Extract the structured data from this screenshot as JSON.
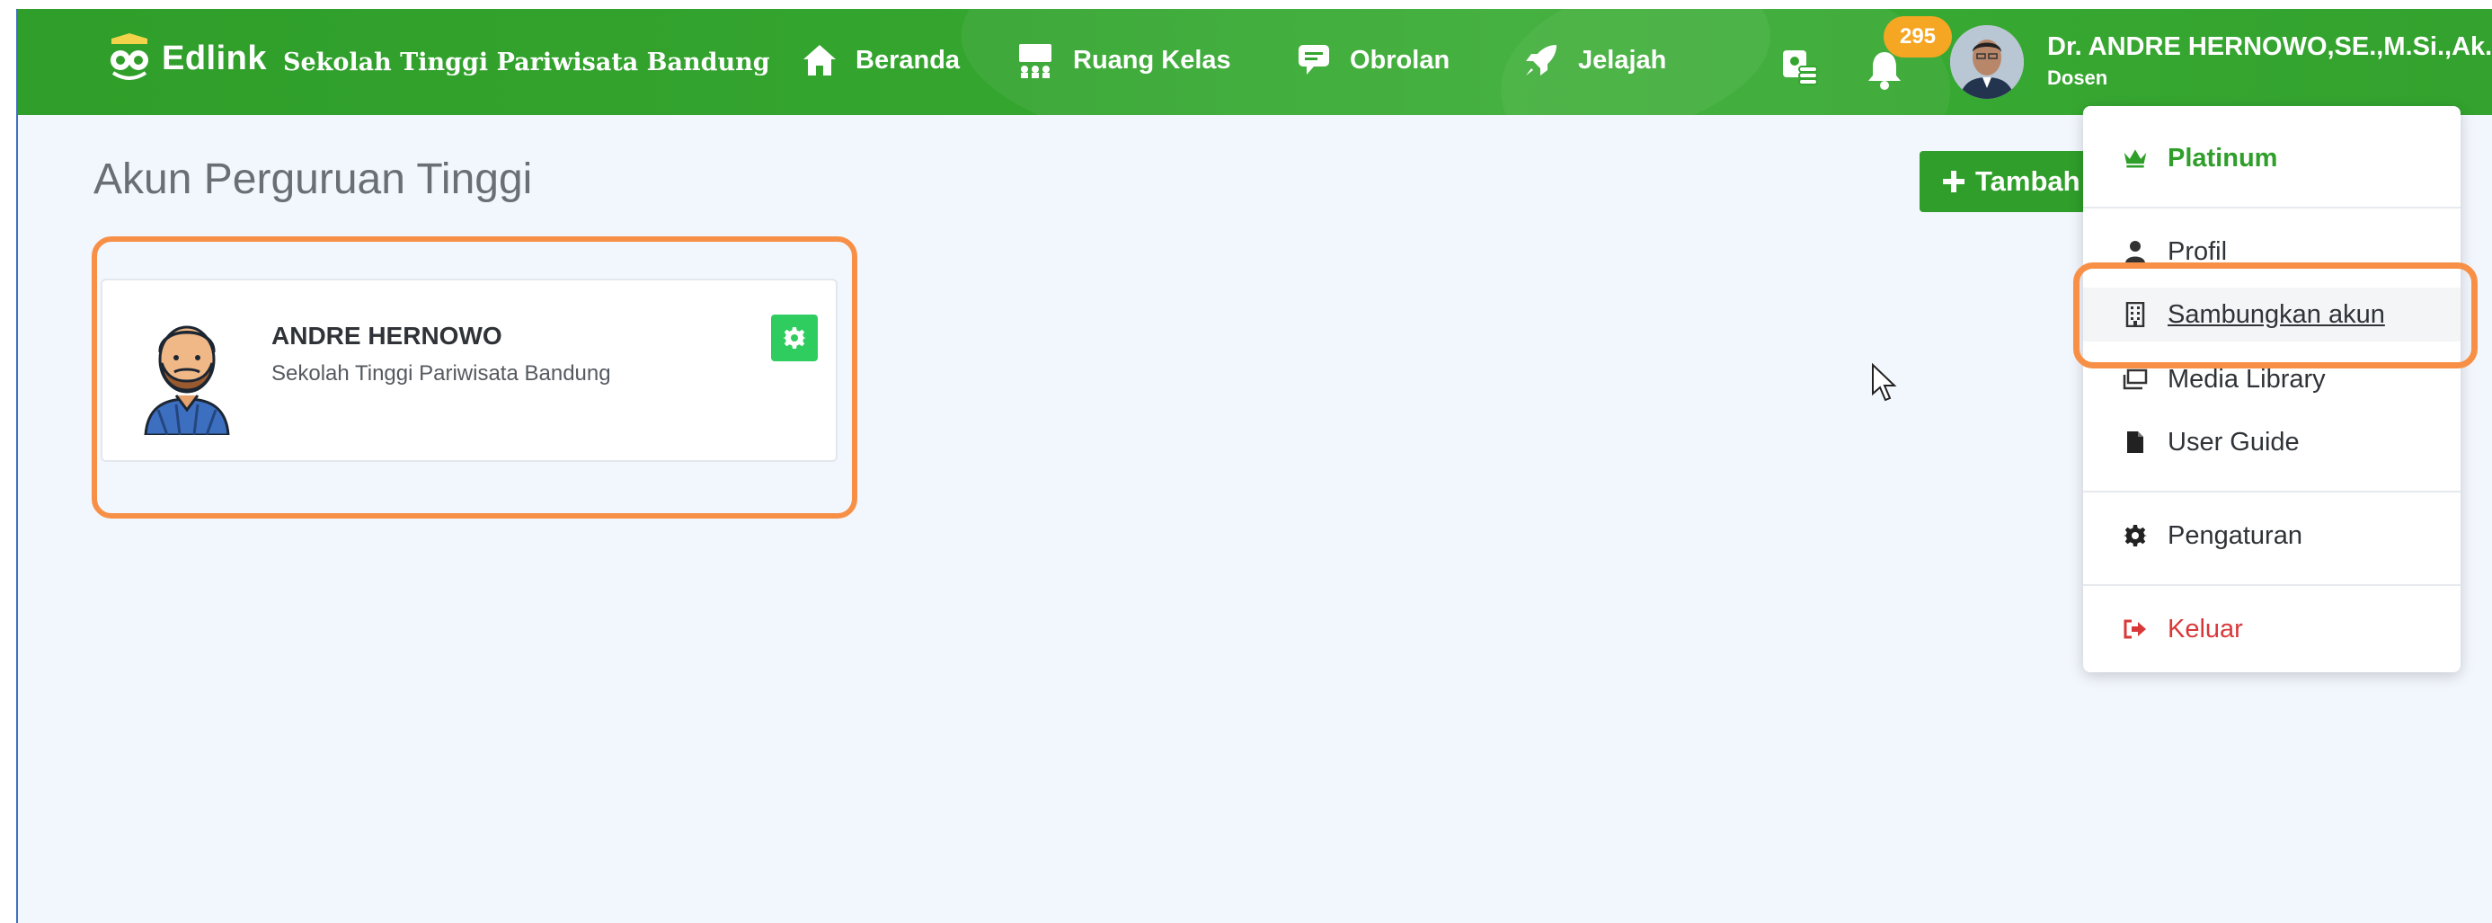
{
  "header": {
    "logo_text": "Edlink",
    "school_name": "Sekolah Tinggi Pariwisata Bandung",
    "nav": [
      {
        "label": "Beranda",
        "icon": "home-icon"
      },
      {
        "label": "Ruang Kelas",
        "icon": "classroom-icon"
      },
      {
        "label": "Obrolan",
        "icon": "chat-icon"
      },
      {
        "label": "Jelajah",
        "icon": "rocket-icon"
      }
    ],
    "notification_count": "295",
    "user_name": "Dr. ANDRE HERNOWO,SE.,M.Si.,Ak.",
    "user_role": "Dosen"
  },
  "main": {
    "title": "Akun Perguruan Tinggi",
    "add_button_label": "Tambah",
    "account": {
      "name": "ANDRE HERNOWO",
      "school": "Sekolah Tinggi Pariwisata Bandung"
    }
  },
  "dropdown": {
    "plan": "Platinum",
    "items": [
      {
        "label": "Profil",
        "icon": "user-icon"
      },
      {
        "label": "Sambungkan akun",
        "icon": "building-icon"
      },
      {
        "label": "Media Library",
        "icon": "media-icon"
      },
      {
        "label": "User Guide",
        "icon": "file-icon"
      },
      {
        "label": "Pengaturan",
        "icon": "gear-icon"
      },
      {
        "label": "Keluar",
        "icon": "logout-icon"
      }
    ]
  },
  "colors": {
    "brand_green": "#2f9e2a",
    "highlight_orange": "#f79046",
    "badge_orange": "#f5a623",
    "danger_red": "#d9383a"
  }
}
